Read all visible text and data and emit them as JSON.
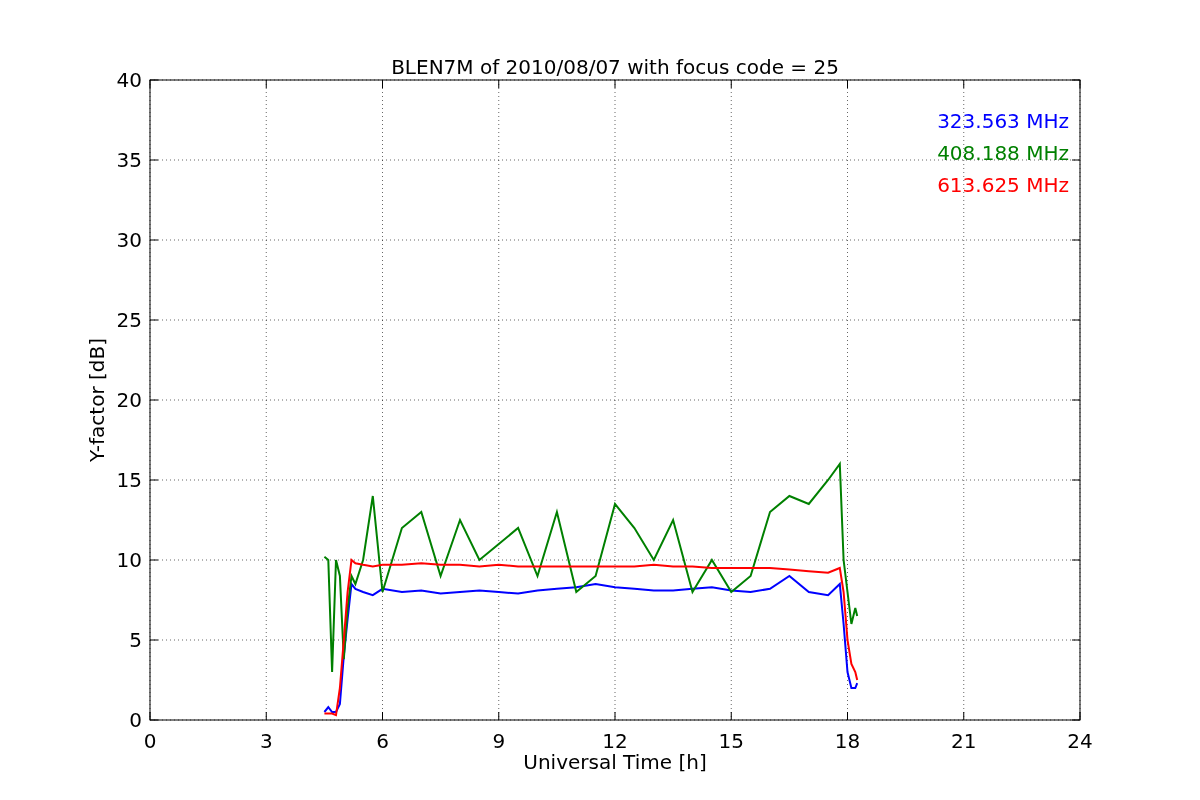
{
  "chart_data": {
    "type": "line",
    "title": "BLEN7M of 2010/08/07 with focus code = 25",
    "xlabel": "Universal Time [h]",
    "ylabel": "Y-factor [dB]",
    "x": [
      4.5,
      4.6,
      4.7,
      4.8,
      4.9,
      5.0,
      5.1,
      5.2,
      5.3,
      5.5,
      5.75,
      6,
      6.5,
      7,
      7.5,
      8,
      8.5,
      9,
      9.5,
      10,
      10.5,
      11,
      11.5,
      12,
      12.5,
      13,
      13.5,
      14,
      14.5,
      15,
      15.5,
      16,
      16.5,
      17,
      17.5,
      17.8,
      17.9,
      18.0,
      18.1,
      18.2,
      18.25
    ],
    "series": [
      {
        "name": "323.563 MHz",
        "color": "#0000ff",
        "values": [
          0.5,
          0.8,
          0.5,
          0.5,
          1,
          4,
          6.3,
          8.5,
          8.2,
          8,
          7.8,
          8.2,
          8,
          8.1,
          7.9,
          8,
          8.1,
          8,
          7.9,
          8.1,
          8.2,
          8.3,
          8.5,
          8.3,
          8.2,
          8.1,
          8.1,
          8.2,
          8.3,
          8.1,
          8,
          8.2,
          9,
          8,
          7.8,
          8.5,
          6,
          3,
          2,
          2,
          2.3
        ]
      },
      {
        "name": "408.188 MHz",
        "color": "#008000",
        "values": [
          10.2,
          10,
          3,
          10,
          9,
          3.8,
          7,
          9,
          8.5,
          10,
          14,
          8,
          12,
          13,
          9,
          12.5,
          10,
          11,
          12,
          9,
          13,
          8,
          9,
          13.5,
          12,
          10,
          12.5,
          8,
          10,
          8,
          9,
          13,
          14,
          13.5,
          15,
          16,
          10,
          8,
          6,
          7,
          6.5
        ]
      },
      {
        "name": "613.625 MHz",
        "color": "#ff0000",
        "values": [
          0.4,
          0.4,
          0.4,
          0.3,
          2,
          5,
          8,
          10,
          9.8,
          9.7,
          9.6,
          9.7,
          9.7,
          9.8,
          9.7,
          9.7,
          9.6,
          9.7,
          9.6,
          9.6,
          9.6,
          9.6,
          9.6,
          9.6,
          9.6,
          9.7,
          9.6,
          9.6,
          9.5,
          9.5,
          9.5,
          9.5,
          9.4,
          9.3,
          9.2,
          9.5,
          8,
          5,
          3.5,
          3,
          2.5
        ]
      }
    ],
    "grid": true,
    "xlim": [
      0,
      24
    ],
    "ylim": [
      0,
      40
    ],
    "xticks": [
      0,
      3,
      6,
      9,
      12,
      15,
      18,
      21,
      24
    ],
    "yticks": [
      0,
      5,
      10,
      15,
      20,
      25,
      30,
      35,
      40
    ]
  }
}
